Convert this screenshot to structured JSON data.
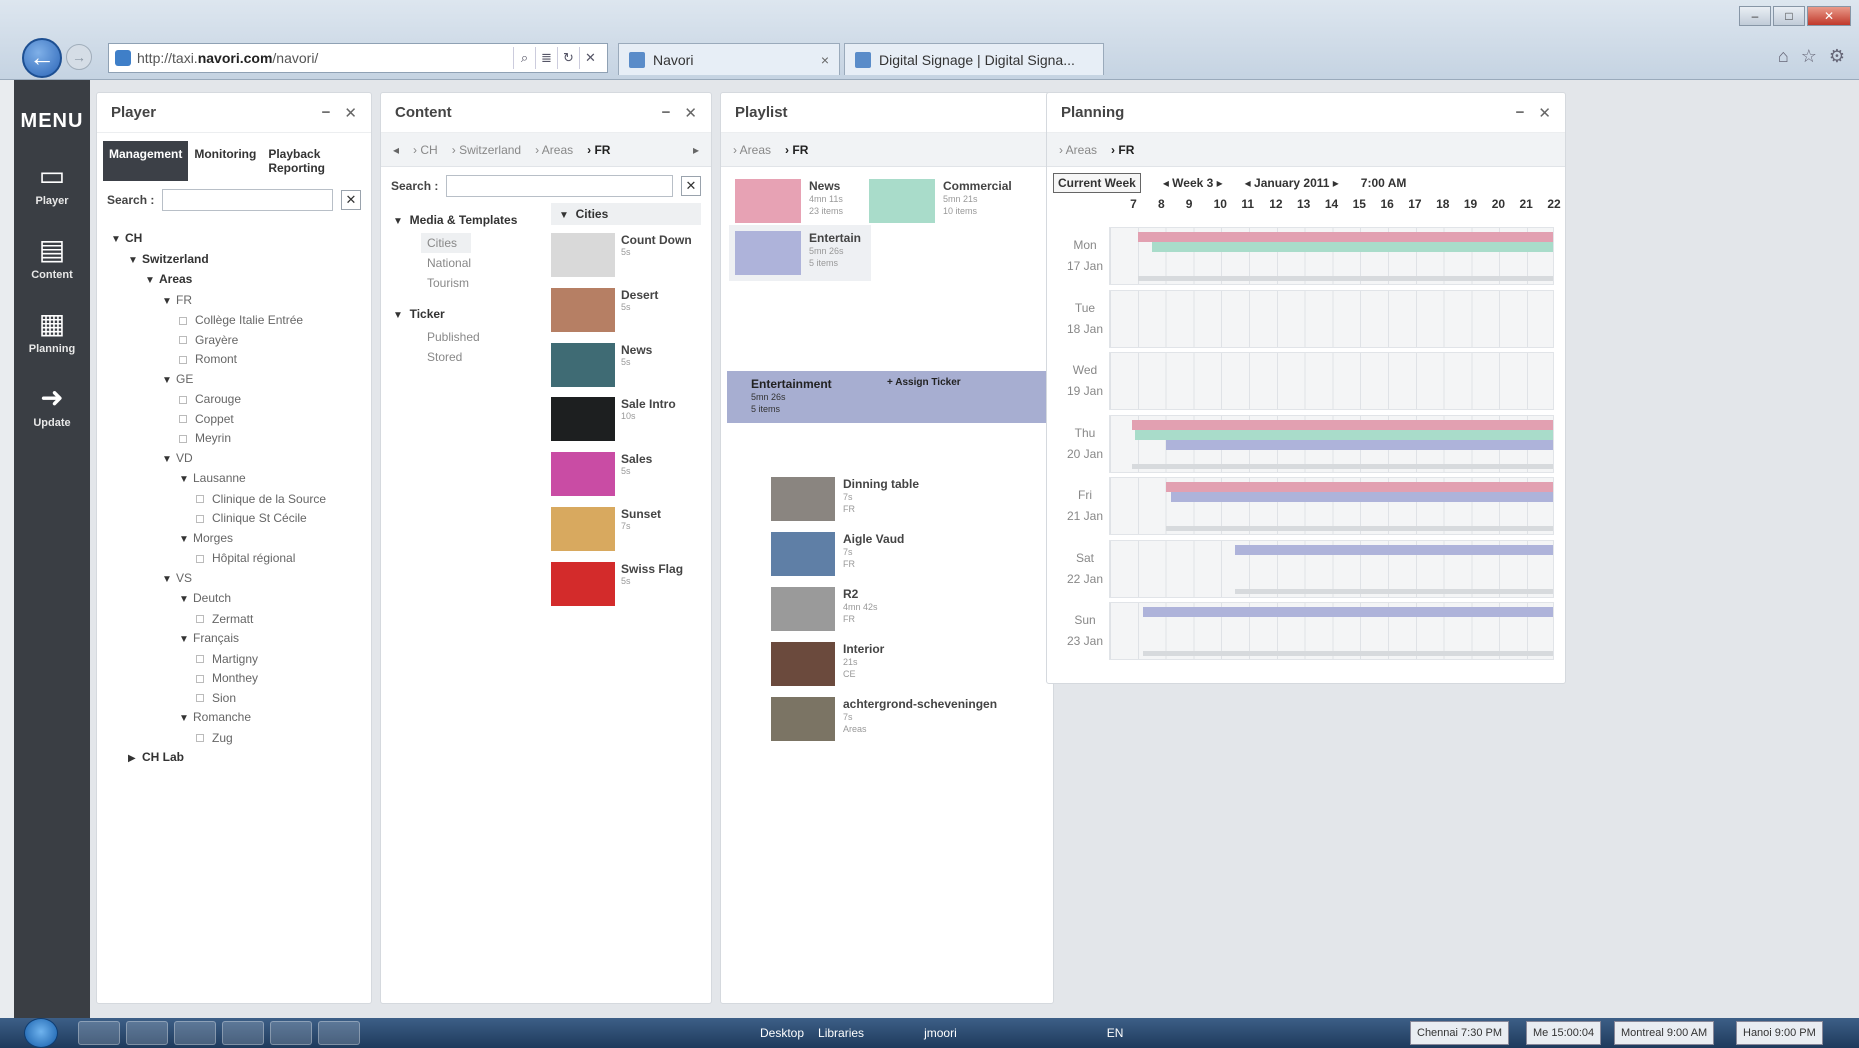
{
  "browser": {
    "url_prefix": "http://taxi.",
    "url_domain": "navori.com",
    "url_path": "/navori/",
    "tabs": [
      {
        "label": "Navori"
      },
      {
        "label": "Digital Signage | Digital Signa..."
      }
    ]
  },
  "menu": {
    "title": "MENU",
    "items": [
      {
        "label": "Player",
        "icon": "monitor-icon"
      },
      {
        "label": "Content",
        "icon": "film-icon"
      },
      {
        "label": "Planning",
        "icon": "calendar-icon"
      },
      {
        "label": "Update",
        "icon": "arrow-right-icon"
      }
    ]
  },
  "player": {
    "title": "Player",
    "tabs": [
      "Management",
      "Monitoring",
      "Playback Reporting"
    ],
    "active_tab": "Management",
    "search_label": "Search :",
    "search_value": "",
    "tree": [
      {
        "label": "CH",
        "level": 0,
        "type": "open",
        "bold": true
      },
      {
        "label": "Switzerland",
        "level": 1,
        "type": "open",
        "bold": true
      },
      {
        "label": "Areas",
        "level": 2,
        "type": "open",
        "bold": true
      },
      {
        "label": "FR",
        "level": 3,
        "type": "open",
        "bold": false
      },
      {
        "label": "Collège Italie Entrée",
        "level": 4,
        "type": "leaf"
      },
      {
        "label": "Grayère",
        "level": 4,
        "type": "leaf"
      },
      {
        "label": "Romont",
        "level": 4,
        "type": "leaf"
      },
      {
        "label": "GE",
        "level": 3,
        "type": "open"
      },
      {
        "label": "Carouge",
        "level": 4,
        "type": "leaf"
      },
      {
        "label": "Coppet",
        "level": 4,
        "type": "leaf"
      },
      {
        "label": "Meyrin",
        "level": 4,
        "type": "leaf"
      },
      {
        "label": "VD",
        "level": 3,
        "type": "open"
      },
      {
        "label": "Lausanne",
        "level": 4,
        "type": "open"
      },
      {
        "label": "Clinique de la Source",
        "level": 5,
        "type": "leaf"
      },
      {
        "label": "Clinique St Cécile",
        "level": 5,
        "type": "leaf"
      },
      {
        "label": "Morges",
        "level": 4,
        "type": "open"
      },
      {
        "label": "Hôpital régional",
        "level": 5,
        "type": "leaf"
      },
      {
        "label": "VS",
        "level": 3,
        "type": "open"
      },
      {
        "label": "Deutch",
        "level": 4,
        "type": "open"
      },
      {
        "label": "Zermatt",
        "level": 5,
        "type": "leaf"
      },
      {
        "label": "Français",
        "level": 4,
        "type": "open"
      },
      {
        "label": "Martigny",
        "level": 5,
        "type": "leaf"
      },
      {
        "label": "Monthey",
        "level": 5,
        "type": "leaf"
      },
      {
        "label": "Sion",
        "level": 5,
        "type": "leaf"
      },
      {
        "label": "Romanche",
        "level": 4,
        "type": "open"
      },
      {
        "label": "Zug",
        "level": 5,
        "type": "leaf"
      },
      {
        "label": "CH Lab",
        "level": 1,
        "type": "closed",
        "bold": true
      }
    ]
  },
  "content": {
    "title": "Content",
    "breadcrumb": [
      "CH",
      "Switzerland",
      "Areas",
      "FR"
    ],
    "search_label": "Search :",
    "search_value": "",
    "groups": [
      {
        "label": "Media & Templates",
        "children": [
          "Cities",
          "National",
          "Tourism"
        ],
        "selected": "Cities"
      },
      {
        "label": "Ticker",
        "children": [
          "Published",
          "Stored"
        ]
      }
    ],
    "folder_header": "Cities",
    "media": [
      {
        "name": "Count Down",
        "dur": "5s",
        "color": "#d9d9d9"
      },
      {
        "name": "Desert",
        "dur": "5s",
        "color": "#b67f64"
      },
      {
        "name": "News",
        "dur": "5s",
        "color": "#3f6b74"
      },
      {
        "name": "Sale Intro",
        "dur": "10s",
        "color": "#1d1f20"
      },
      {
        "name": "Sales",
        "dur": "5s",
        "color": "#c94ca4"
      },
      {
        "name": "Sunset",
        "dur": "7s",
        "color": "#d8a95f"
      },
      {
        "name": "Swiss Flag",
        "dur": "5s",
        "color": "#d32b2b"
      }
    ]
  },
  "playlist": {
    "title": "Playlist",
    "breadcrumb": [
      "Areas",
      "FR"
    ],
    "cards": [
      {
        "name": "News",
        "sub1": "4mn 11s",
        "sub2": "23 items",
        "color": "#e7a2b4"
      },
      {
        "name": "Commercial",
        "sub1": "5mn 21s",
        "sub2": "10 items",
        "color": "#a9dcca"
      },
      {
        "name": "Entertain",
        "sub1": "5mn 26s",
        "sub2": "5 items",
        "color": "#aeb3da"
      }
    ],
    "selected": {
      "name": "Entertainment",
      "sub1": "5mn 26s",
      "sub2": "5 items",
      "assign": "Assign Ticker"
    },
    "items": [
      {
        "name": "Dinning table",
        "sub1": "7s",
        "sub2": "FR",
        "color": "#8a8580"
      },
      {
        "name": "Aigle Vaud",
        "sub1": "7s",
        "sub2": "FR",
        "color": "#5f7fa6"
      },
      {
        "name": "R2",
        "sub1": "4mn 42s",
        "sub2": "FR",
        "color": "#9a9a9a"
      },
      {
        "name": "Interior",
        "sub1": "21s",
        "sub2": "CE",
        "color": "#6b4a3d"
      },
      {
        "name": "achtergrond-scheveningen",
        "sub1": "7s",
        "sub2": "Areas",
        "color": "#7b7464"
      }
    ]
  },
  "planning": {
    "title": "Planning",
    "breadcrumb": [
      "Areas",
      "FR"
    ],
    "current_week_label": "Current Week",
    "week_label": "Week 3",
    "month_label": "January 2011",
    "time_label": "7:00 AM",
    "hours": [
      "7",
      "8",
      "9",
      "10",
      "11",
      "12",
      "13",
      "14",
      "15",
      "16",
      "17",
      "18",
      "19",
      "20",
      "21",
      "22"
    ],
    "days": [
      {
        "day": "Mon",
        "date": "17 Jan"
      },
      {
        "day": "Tue",
        "date": "18 Jan"
      },
      {
        "day": "Wed",
        "date": "19 Jan"
      },
      {
        "day": "Thu",
        "date": "20 Jan"
      },
      {
        "day": "Fri",
        "date": "21 Jan"
      },
      {
        "day": "Sat",
        "date": "22 Jan"
      },
      {
        "day": "Sun",
        "date": "23 Jan"
      }
    ],
    "schedule": [
      {
        "day": 0,
        "playlist": "News",
        "color": "pink",
        "start": 8.0,
        "end": 23.0
      },
      {
        "day": 0,
        "playlist": "Commercial",
        "color": "green",
        "start": 8.5,
        "end": 23.0
      },
      {
        "day": 3,
        "playlist": "News",
        "color": "pink",
        "start": 7.8,
        "end": 23.0
      },
      {
        "day": 3,
        "playlist": "Commercial",
        "color": "green",
        "start": 7.9,
        "end": 23.0
      },
      {
        "day": 3,
        "playlist": "Entertain",
        "color": "blue",
        "start": 9.0,
        "end": 23.0
      },
      {
        "day": 4,
        "playlist": "News",
        "color": "pink",
        "start": 9.0,
        "end": 23.0
      },
      {
        "day": 4,
        "playlist": "Entertain",
        "color": "blue",
        "start": 9.2,
        "end": 23.0
      },
      {
        "day": 5,
        "playlist": "Entertain",
        "color": "blue",
        "start": 11.5,
        "end": 23.0
      },
      {
        "day": 6,
        "playlist": "Entertain",
        "color": "blue",
        "start": 8.2,
        "end": 23.0
      }
    ]
  },
  "taskbar": {
    "desktop_label": "Desktop",
    "libraries_label": "Libraries",
    "folder_label": "jmoori",
    "lang": "EN",
    "clocks": [
      "Chennai 7:30 PM",
      "Me 15:00:04",
      "Montreal 9:00 AM",
      "Hanoi 9:00 PM"
    ]
  }
}
